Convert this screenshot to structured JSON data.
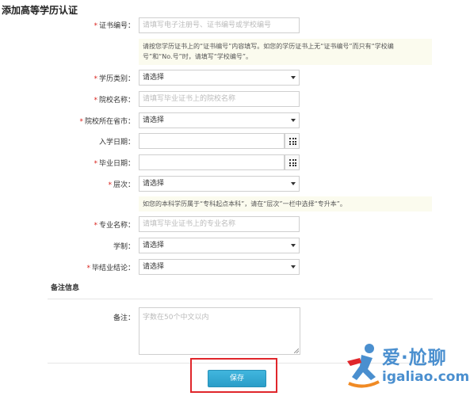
{
  "page": {
    "title": "添加高等学历认证"
  },
  "form": {
    "cert_no": {
      "label": "证书编号：",
      "placeholder": "请填写电子注册号、证书编号或学校编号"
    },
    "cert_tip": {
      "line1": "请按您学历证书上的“证书编号”内容填写。如您的学历证书上无“证书编号”而只有“学校编",
      "line2": "号”和“No.号”时，请填写“学校编号”。"
    },
    "edu_type": {
      "label": "学历类别：",
      "value": "请选择"
    },
    "school_name": {
      "label": "院校名称：",
      "placeholder": "请填写毕业证书上的院校名称"
    },
    "school_province": {
      "label": "院校所在省市：",
      "value": "请选择"
    },
    "enroll_date": {
      "label": "入学日期："
    },
    "grad_date": {
      "label": "毕业日期："
    },
    "level": {
      "label": "层次：",
      "value": "请选择"
    },
    "level_tip": "如您的本科学历属于“专科起点本科”，请在“层次”一栏中选择“专升本”。",
    "major": {
      "label": "专业名称：",
      "placeholder": "请填写毕业证书上的专业名称"
    },
    "duration": {
      "label": "学制：",
      "value": "请选择"
    },
    "conclusion": {
      "label": "毕结业结论：",
      "value": "请选择"
    },
    "remarks_section": "备注信息",
    "remarks": {
      "label": "备注：",
      "placeholder": "字数在50个中文以内"
    },
    "required_mark": "*",
    "save_label": "保存"
  },
  "watermark": {
    "cn": "爱·尬聊",
    "en": "igaliao.com"
  },
  "colors": {
    "required": "#d9231d",
    "button": "#2a9dc8",
    "highlight": "#e0262b",
    "watermark": "#4a8fcf"
  }
}
